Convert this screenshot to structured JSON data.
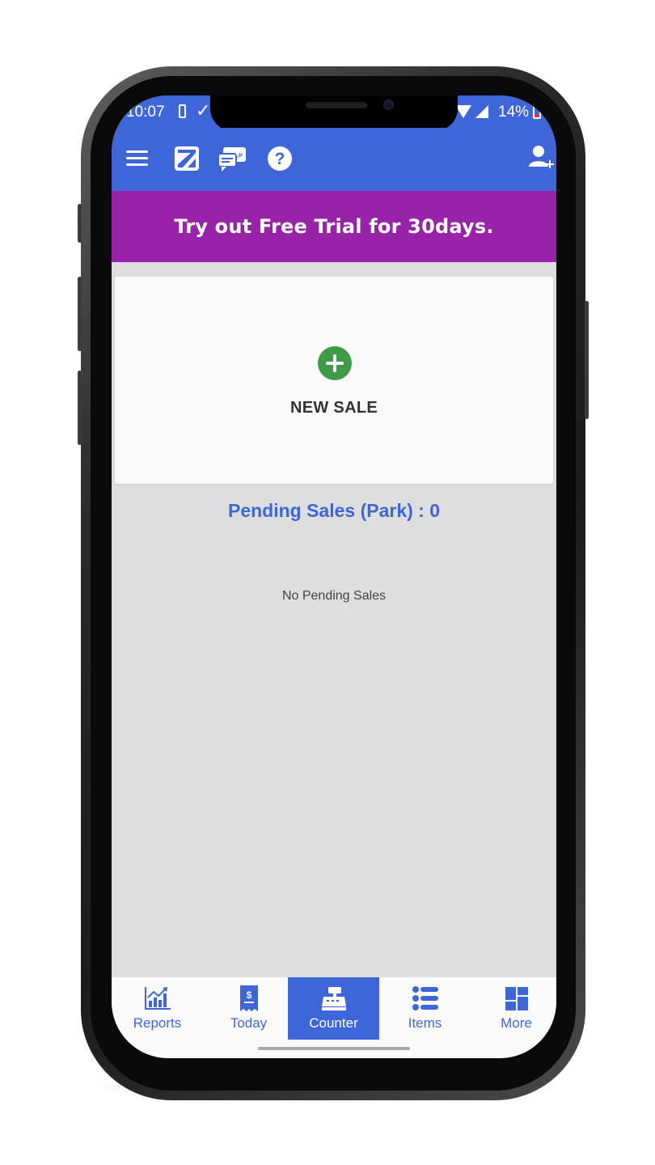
{
  "status_bar": {
    "time": "10:07",
    "battery_percent": "14%"
  },
  "app_bar": {
    "icons": [
      "menu-icon",
      "logo-icon",
      "help-chat-icon",
      "question-icon",
      "add-user-icon"
    ],
    "help_badge": "HELP"
  },
  "banner": {
    "text": "Try out Free Trial for 30days."
  },
  "new_sale": {
    "label": "NEW SALE"
  },
  "pending": {
    "title": "Pending Sales (Park) : 0",
    "empty_text": "No Pending Sales"
  },
  "bottom_nav": {
    "items": [
      {
        "label": "Reports",
        "icon": "reports-icon",
        "active": false
      },
      {
        "label": "Today",
        "icon": "receipt-icon",
        "active": false
      },
      {
        "label": "Counter",
        "icon": "cash-register-icon",
        "active": true
      },
      {
        "label": "Items",
        "icon": "list-icon",
        "active": false
      },
      {
        "label": "More",
        "icon": "grid-icon",
        "active": false
      }
    ]
  },
  "colors": {
    "primary": "#3e66d8",
    "banner": "#9823a8",
    "add_button": "#3f9a47",
    "background": "#dedede"
  }
}
